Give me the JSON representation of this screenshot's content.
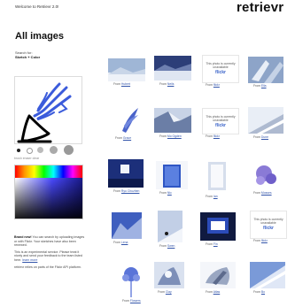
{
  "header": {
    "welcome": "Welcome to Retrievr 2.0!",
    "brand": "retrievr"
  },
  "page": {
    "title": "All images"
  },
  "search": {
    "label": "Search for:",
    "value": "Sketch + Color"
  },
  "sketch": {
    "tools_label": "brush  eraser  clear"
  },
  "palette": {
    "accent": "#3b5bdb"
  },
  "info": {
    "p1_lead": "Brand new!",
    "p1_rest": " You can search by uploading images or with Flickr. Your sketches have also been renewed.",
    "p2": "This is an experimental service. Please treat it nicely and send your feedback to the team listed here.",
    "p2_link": "learn more",
    "p3": "retrievr relies on parts of the Flickr API platform."
  },
  "results": {
    "caption_prefix": "From",
    "not_available": "This photo is currently unavailable",
    "flickr_logo": "flickr",
    "items": [
      {
        "source": "Hubert",
        "kind": "photo"
      },
      {
        "source": "Neils",
        "kind": "photo"
      },
      {
        "source": "flickr",
        "kind": "unavailable"
      },
      {
        "source": "Ella",
        "kind": "photo"
      },
      {
        "source": "Grace",
        "kind": "photo"
      },
      {
        "source": "Mo Ogden",
        "kind": "photo"
      },
      {
        "source": "flickr",
        "kind": "unavailable"
      },
      {
        "source": "Dune",
        "kind": "photo"
      },
      {
        "source": "Ryu Chuzhen",
        "kind": "photo"
      },
      {
        "source": "Nic",
        "kind": "photo"
      },
      {
        "source": "Ian",
        "kind": "photo"
      },
      {
        "source": "Mosses",
        "kind": "photo"
      },
      {
        "source": "Lena",
        "kind": "photo"
      },
      {
        "source": "Swen",
        "kind": "photo"
      },
      {
        "source": "Fin",
        "kind": "photo"
      },
      {
        "source": "flickr",
        "kind": "unavailable"
      },
      {
        "source": "Flowers",
        "kind": "photo"
      },
      {
        "source": "Clay",
        "kind": "photo"
      },
      {
        "source": "Atlas",
        "kind": "photo"
      },
      {
        "source": "Bo",
        "kind": "photo"
      }
    ]
  }
}
